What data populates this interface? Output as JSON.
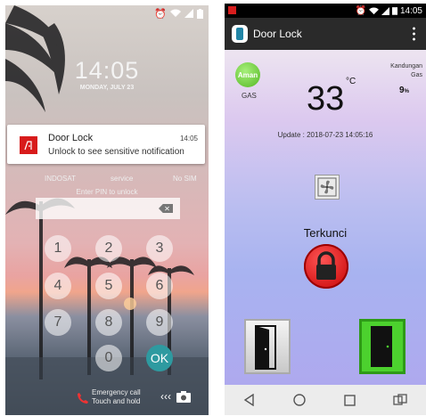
{
  "lock_screen": {
    "status_icons": [
      "alarm-icon",
      "wifi-icon",
      "signal-icon",
      "battery-icon"
    ],
    "clock": "14:05",
    "date": "MONDAY, JULY 23",
    "notification": {
      "title": "Door Lock",
      "body": "Unlock to see sensitive notification",
      "time": "14:05"
    },
    "carrier_left": "INDOSAT",
    "carrier_mid": "service",
    "carrier_right": "No SIM",
    "pin_hint": "Enter PIN to unlock",
    "keys": [
      "1",
      "2",
      "3",
      "4",
      "5",
      "6",
      "7",
      "8",
      "9",
      "0",
      "OK"
    ],
    "emergency_line1": "Emergency call",
    "emergency_line2": "Touch and hold",
    "chevrons": "‹‹‹"
  },
  "app": {
    "status_time": "14:05",
    "title": "Door Lock",
    "gas_status": "Aman",
    "gas_label": "GAS",
    "temperature": "33",
    "temperature_unit": "°C",
    "gas_content_line1": "Kandungan",
    "gas_content_line2": "Gas",
    "gas_value": "9",
    "gas_unit": "%",
    "update_text": "Update : 2018-07-23 14:05:16",
    "lock_status": "Terkunci",
    "colors": {
      "app_bar": "#2a2a2a",
      "gas_ok": "#55b824",
      "lock_red": "#d40000",
      "door_closed_green": "#4cd12e"
    }
  }
}
